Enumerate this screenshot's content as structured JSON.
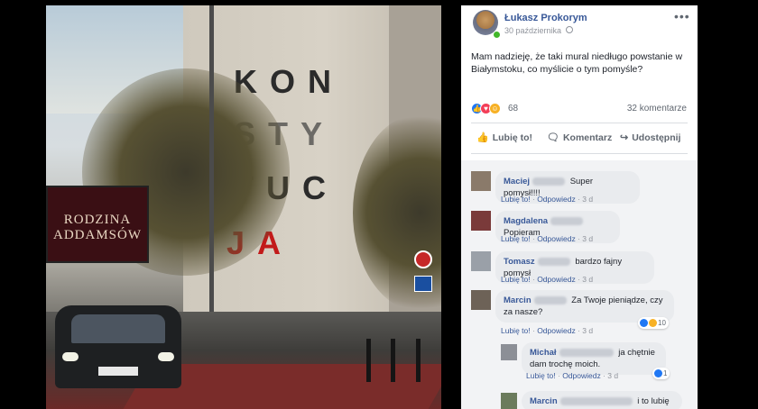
{
  "post": {
    "author": "Łukasz Prokorym",
    "date": "30 października",
    "more_label": "•••",
    "text": "Mam nadzieję, że taki mural niedługo powstanie w Białymstoku, co myślicie o tym pomyśle?",
    "reaction_count": "68",
    "comments_count": "32 komentarze",
    "reactions": [
      "like",
      "love",
      "haha"
    ]
  },
  "photo": {
    "mural_rows": [
      "KON",
      "STY",
      "TUC",
      "JA"
    ],
    "billboard_title": "RODZINA ADDAMSÓW"
  },
  "actions": {
    "like": "Lubię to!",
    "comment": "Komentarz",
    "share": "Udostępnij"
  },
  "comments": [
    {
      "name": "Maciej",
      "text": "Super pomysł!!!!",
      "like": "Lubię to!",
      "reply": "Odpowiedz",
      "time": "3 d"
    },
    {
      "name": "Magdalena",
      "text": "Popieram",
      "like": "Lubię to!",
      "reply": "Odpowiedz",
      "time": "3 d"
    },
    {
      "name": "Tomasz",
      "text": "bardzo fajny pomysł",
      "like": "Lubię to!",
      "reply": "Odpowiedz",
      "time": "3 d"
    },
    {
      "name": "Marcin",
      "text": "Za Twoje pieniądze, czy za nasze?",
      "like": "Lubię to!",
      "reply": "Odpowiedz",
      "time": "3 d",
      "reactions": "10"
    },
    {
      "name": "Michał",
      "text": "ja chętnie dam trochę moich.",
      "like": "Lubię to!",
      "reply": "Odpowiedz",
      "time": "3 d",
      "reactions": "1"
    },
    {
      "name": "Marcin",
      "text": "i to lubię",
      "like": "",
      "reply": "",
      "time": ""
    }
  ],
  "colors": {
    "link": "#385898",
    "meta": "#90949c",
    "bubble": "#e9ebee",
    "like_blue": "#2078f4",
    "love_red": "#f33e58",
    "haha_yellow": "#f7b125"
  },
  "icons": {
    "like_action": "thumbs-up-icon",
    "comment_action": "speech-bubble-icon",
    "share_action": "share-arrow-icon",
    "audience": "globe-icon"
  }
}
